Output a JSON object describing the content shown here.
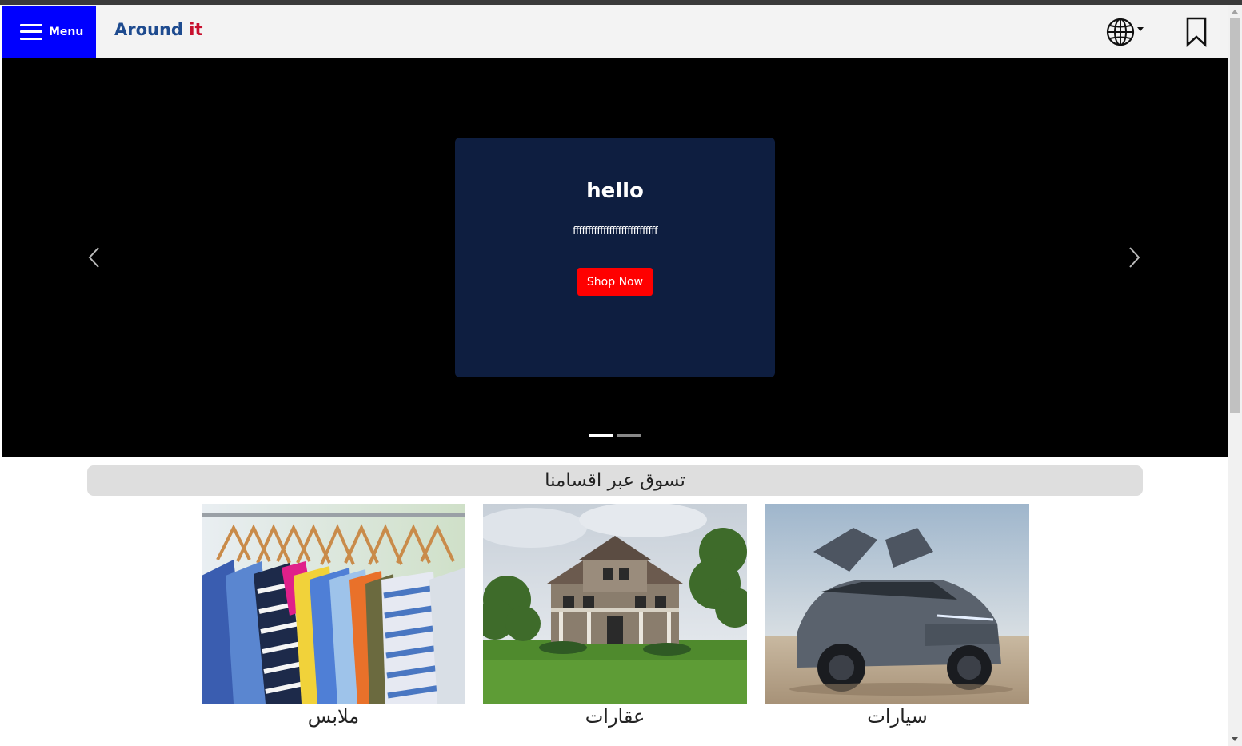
{
  "header": {
    "menu_label": "Menu",
    "brand_part1": "Around",
    "brand_part2": "it",
    "language_icon": "globe-icon",
    "bookmark_icon": "bookmark-icon"
  },
  "hero": {
    "title": "hello",
    "text": "ffffffffffffffffffffffffffff",
    "button_label": "Shop Now",
    "slide_count": 2,
    "active_slide": 1,
    "colors": {
      "card_bg": "#0e1e40",
      "button_bg": "#ff0000",
      "bg": "#000000"
    }
  },
  "categories_section": {
    "heading": "تسوق عبر اقسامنا",
    "items": [
      {
        "label": "ملابس",
        "image": "clothes-on-hangers-image"
      },
      {
        "label": "عقارات",
        "image": "house-image"
      },
      {
        "label": "سيارات",
        "image": "car-image"
      }
    ]
  },
  "colors": {
    "menu_bg": "#0000ff",
    "brand_blue": "#1e4b8f",
    "brand_red": "#c8102e"
  }
}
